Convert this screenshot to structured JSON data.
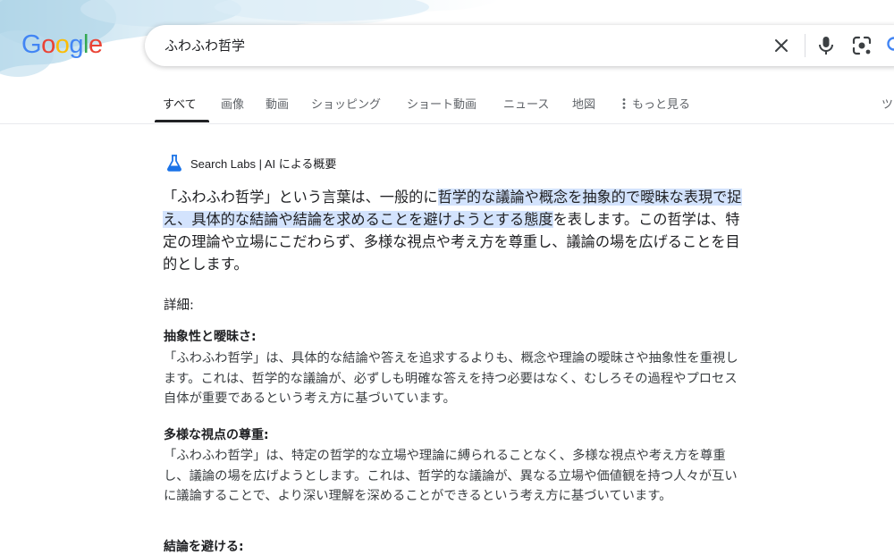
{
  "logo": {
    "letters": [
      "G",
      "o",
      "o",
      "g",
      "l",
      "e"
    ],
    "colors": [
      "#4285f4",
      "#ea4335",
      "#fbbc05",
      "#4285f4",
      "#34a853",
      "#ea4335"
    ]
  },
  "search": {
    "query": "ふわふわ哲学"
  },
  "icons": {
    "clear": "close-icon",
    "voice": "microphone-icon",
    "lens": "lens-icon",
    "search": "search-icon",
    "ai": "flask-icon",
    "more": "vertical-dots-icon"
  },
  "tabs": [
    {
      "label": "すべて",
      "active": true
    },
    {
      "label": "画像"
    },
    {
      "label": "動画"
    },
    {
      "label": "ショッピング"
    },
    {
      "label": "ショート動画"
    },
    {
      "label": "ニュース"
    },
    {
      "label": "地図"
    },
    {
      "label": "もっと見る"
    },
    {
      "label": "ツ"
    }
  ],
  "ai_overview": {
    "label": "Search Labs | AI による概要",
    "summary": {
      "pre": "「ふわふわ哲学」という言葉は、一般的に",
      "highlight": "哲学的な議論や概念を抽象的で曖昧な表現で捉え、具体的な結論や結論を求めることを避けようとする態度",
      "post": "を表します。この哲学は、特定の理論や立場にこだわらず、多様な視点や考え方を尊重し、議論の場を広げることを目的とします。"
    },
    "details_heading": "詳細:",
    "sections": [
      {
        "title": "抽象性と曖昧さ:",
        "body": "「ふわふわ哲学」は、具体的な結論や答えを追求するよりも、概念や理論の曖昧さや抽象性を重視します。これは、哲学的な議論が、必ずしも明確な答えを持つ必要はなく、むしろその過程やプロセス自体が重要であるという考え方に基づいています。"
      },
      {
        "title": "多様な視点の尊重:",
        "body": "「ふわふわ哲学」は、特定の哲学的な立場や理論に縛られることなく、多様な視点や考え方を尊重し、議論の場を広げようとします。これは、哲学的な議論が、異なる立場や価値観を持つ人々が互いに議論することで、より深い理解を深めることができるという考え方に基づいています。"
      },
      {
        "title": "結論を避ける:"
      }
    ]
  },
  "colors": {
    "accent": "#1a73e8",
    "highlight": "#d3e3fd",
    "logo_blue": "#4285f4"
  }
}
